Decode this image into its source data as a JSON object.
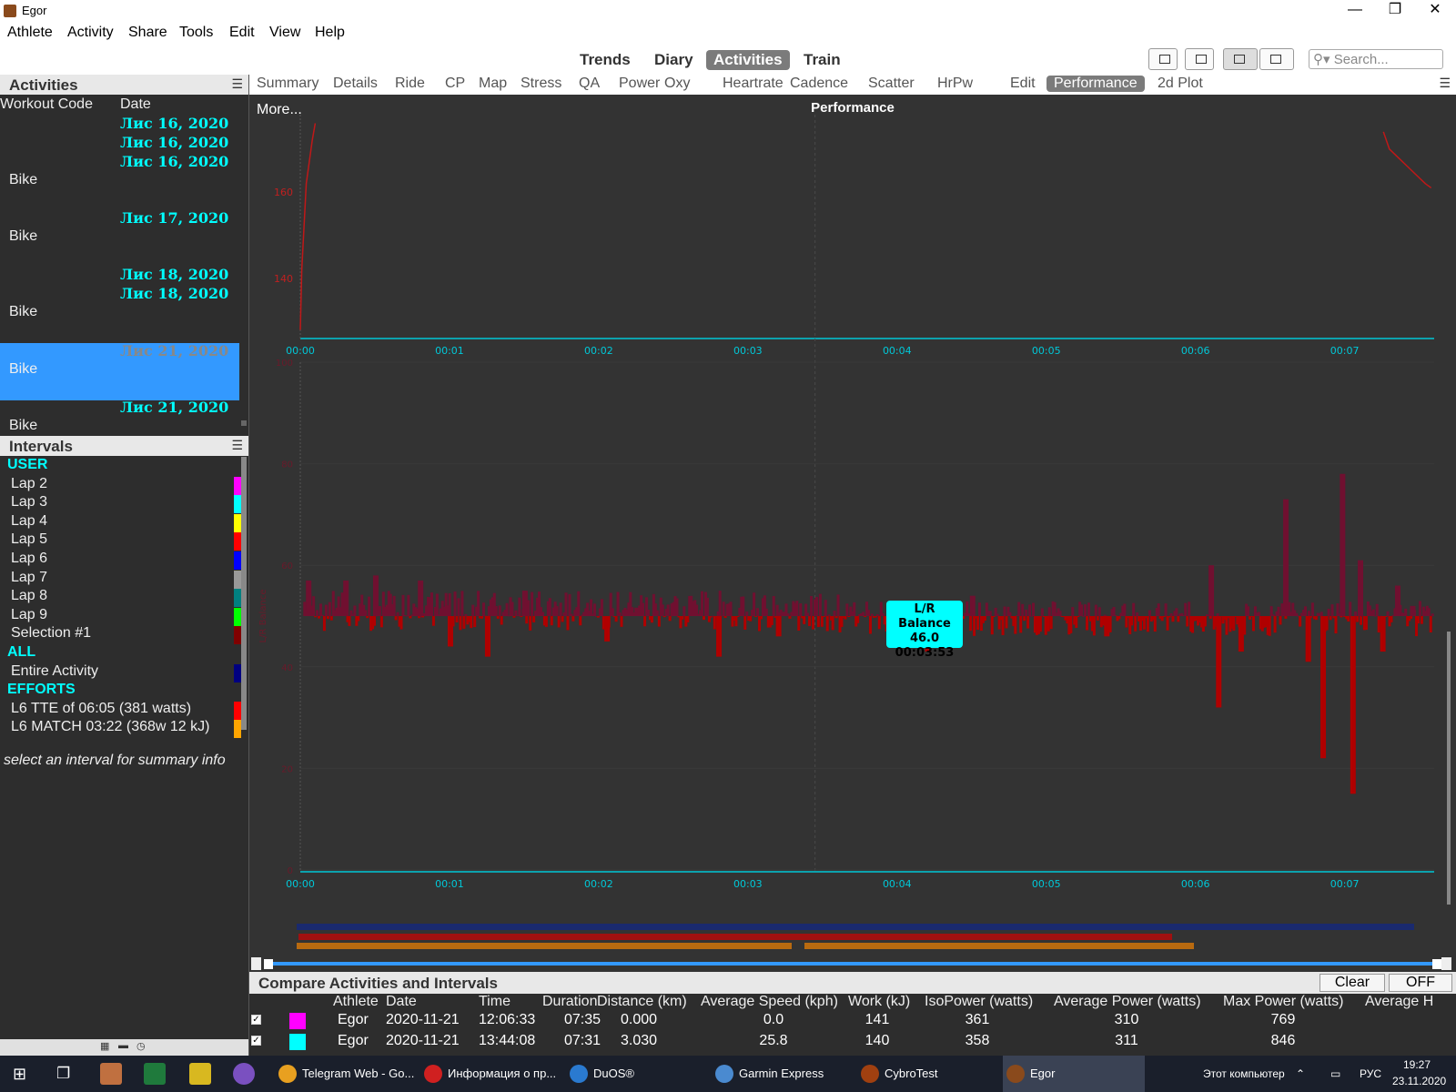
{
  "window": {
    "title": "Egor"
  },
  "menu": [
    "Athlete",
    "Activity",
    "Share",
    "Tools",
    "Edit",
    "View",
    "Help"
  ],
  "views": [
    "Trends",
    "Diary",
    "Activities",
    "Train"
  ],
  "search": {
    "placeholder": "Search..."
  },
  "activities": {
    "title": "Activities",
    "col_code": "Workout Code",
    "col_date": "Date",
    "rows": [
      {
        "date": "Лис 16, 2020",
        "code": ""
      },
      {
        "date": "Лис 16, 2020",
        "code": ""
      },
      {
        "date": "Лис 16, 2020",
        "code": "Bike"
      },
      {
        "date": "Лис 17, 2020",
        "code": "Bike"
      },
      {
        "date": "Лис 18, 2020",
        "code": ""
      },
      {
        "date": "Лис 18, 2020",
        "code": "Bike"
      },
      {
        "date": "Лис 21, 2020",
        "code": "Bike",
        "selected": true
      },
      {
        "date": "Лис 21, 2020",
        "code": "Bike"
      }
    ]
  },
  "intervals": {
    "title": "Intervals",
    "groups": [
      {
        "name": "USER",
        "items": [
          {
            "label": "Lap 2",
            "color": "#ff00ff"
          },
          {
            "label": "Lap 3",
            "color": "#00ffff"
          },
          {
            "label": "Lap 4",
            "color": "#ffff00"
          },
          {
            "label": "Lap 5",
            "color": "#ff0000"
          },
          {
            "label": "Lap 6",
            "color": "#0000ff"
          },
          {
            "label": "Lap 7",
            "color": "#999999"
          },
          {
            "label": "Lap 8",
            "color": "#008080"
          },
          {
            "label": "Lap 9",
            "color": "#00ff00"
          },
          {
            "label": "Selection #1",
            "color": "#800000"
          }
        ]
      },
      {
        "name": "ALL",
        "items": [
          {
            "label": "Entire Activity",
            "color": "#000080"
          }
        ]
      },
      {
        "name": "EFFORTS",
        "items": [
          {
            "label": "L6 TTE of 06:05  (381 watts)",
            "color": "#ff0000"
          },
          {
            "label": "L6 MATCH 03:22 (368w 12 kJ)",
            "color": "#ffa500"
          }
        ]
      }
    ],
    "hint": "select an interval for summary info"
  },
  "tabs": [
    "Summary",
    "Details",
    "Ride",
    "CP",
    "Map",
    "Stress",
    "QA",
    "Power",
    "Oxy",
    "Heartrate",
    "Cadence",
    "Scatter",
    "HrPw",
    "Edit",
    "Performance",
    "2d Plot"
  ],
  "selected_tab": "Performance",
  "chart": {
    "more": "More...",
    "title": "Performance",
    "x_ticks": [
      "00:00",
      "00:01",
      "00:02",
      "00:03",
      "00:04",
      "00:05",
      "00:06",
      "00:07"
    ],
    "top_y_ticks": [
      "140",
      "160"
    ],
    "bottom_y_ticks": [
      "0",
      "20",
      "40",
      "60",
      "80",
      "100"
    ],
    "bottom_ylabel": "L/R Balance",
    "tooltip": {
      "name": "L/R Balance",
      "value": "46.0",
      "time": "00:03:53"
    },
    "colors": {
      "axis": "#00c8d8",
      "line": "#c01818",
      "bar_up": "#701030",
      "bar_down": "#b00000",
      "tick_top": "#c02020",
      "tick_bottom": "#6a1a2a"
    }
  },
  "chart_data": [
    {
      "type": "line",
      "series": [
        {
          "values": [
            [
              0,
              128
            ],
            [
              0.01,
              142
            ],
            [
              0.04,
              162
            ],
            [
              0.08,
              172
            ],
            [
              0.1,
              176
            ]
          ]
        },
        {
          "values": [
            [
              7.26,
              174
            ],
            [
              7.3,
              170
            ],
            [
              7.36,
              168
            ],
            [
              7.42,
              166
            ],
            [
              7.48,
              164
            ],
            [
              7.54,
              162
            ],
            [
              7.58,
              161
            ]
          ]
        }
      ],
      "xlim": [
        0,
        7.6
      ],
      "ylim": [
        126,
        178
      ],
      "xlabel": "",
      "ylabel": ""
    },
    {
      "type": "bar",
      "ylabel": "L/R Balance",
      "xlim": [
        0,
        7.6
      ],
      "ylim": [
        0,
        100
      ],
      "baseline": 50,
      "spikes": [
        [
          0.05,
          57
        ],
        [
          0.3,
          57
        ],
        [
          0.5,
          58
        ],
        [
          0.8,
          57
        ],
        [
          1.0,
          44
        ],
        [
          1.25,
          42
        ],
        [
          1.5,
          55
        ],
        [
          2.05,
          45
        ],
        [
          2.8,
          42
        ],
        [
          3.2,
          46
        ],
        [
          3.95,
          46
        ],
        [
          4.2,
          43
        ],
        [
          4.5,
          54
        ],
        [
          5.0,
          47
        ],
        [
          5.4,
          46
        ],
        [
          6.1,
          60
        ],
        [
          6.15,
          32
        ],
        [
          6.3,
          43
        ],
        [
          6.6,
          73
        ],
        [
          6.75,
          41
        ],
        [
          6.85,
          22
        ],
        [
          6.98,
          78
        ],
        [
          7.05,
          15
        ],
        [
          7.1,
          61
        ],
        [
          7.25,
          43
        ],
        [
          7.35,
          56
        ],
        [
          7.45,
          52
        ]
      ]
    }
  ],
  "timeline_bars": [
    {
      "color": "#1a2a6e"
    },
    {
      "color": "#a01010"
    },
    {
      "color": "#b86a10"
    },
    {
      "color": "#b86a10"
    }
  ],
  "compare": {
    "title": "Compare Activities and Intervals",
    "clear": "Clear",
    "off": "OFF",
    "headers": [
      "Athlete",
      "Date",
      "Time",
      "Duration",
      "Distance (km)",
      "Average Speed (kph)",
      "Work (kJ)",
      "IsoPower (watts)",
      "Average Power (watts)",
      "Max Power (watts)",
      "Average H"
    ],
    "rows": [
      {
        "color": "#ff00ff",
        "athlete": "Egor",
        "date": "2020-11-21",
        "time": "12:06:33",
        "duration": "07:35",
        "distance": "0.000",
        "speed": "0.0",
        "work": "141",
        "iso": "361",
        "avgp": "310",
        "maxp": "769"
      },
      {
        "color": "#00ffff",
        "athlete": "Egor",
        "date": "2020-11-21",
        "time": "13:44:08",
        "duration": "07:31",
        "distance": "3.030",
        "speed": "25.8",
        "work": "140",
        "iso": "358",
        "avgp": "311",
        "maxp": "846"
      }
    ]
  },
  "taskbar": {
    "apps": [
      {
        "label": "Telegram Web - Go...",
        "color": "#e8a020"
      },
      {
        "label": "Информация о пр...",
        "color": "#d02020"
      },
      {
        "label": "DuOS®",
        "color": "#2a7ad0"
      },
      {
        "label": "Garmin Express",
        "color": "#4a8ad0"
      },
      {
        "label": "CybroTest",
        "color": "#a04010"
      },
      {
        "label": "Egor",
        "color": "#8a4a1c",
        "active": true
      }
    ],
    "tray_label": "Этот компьютер",
    "lang": "РУС",
    "time": "19:27",
    "date": "23.11.2020"
  }
}
